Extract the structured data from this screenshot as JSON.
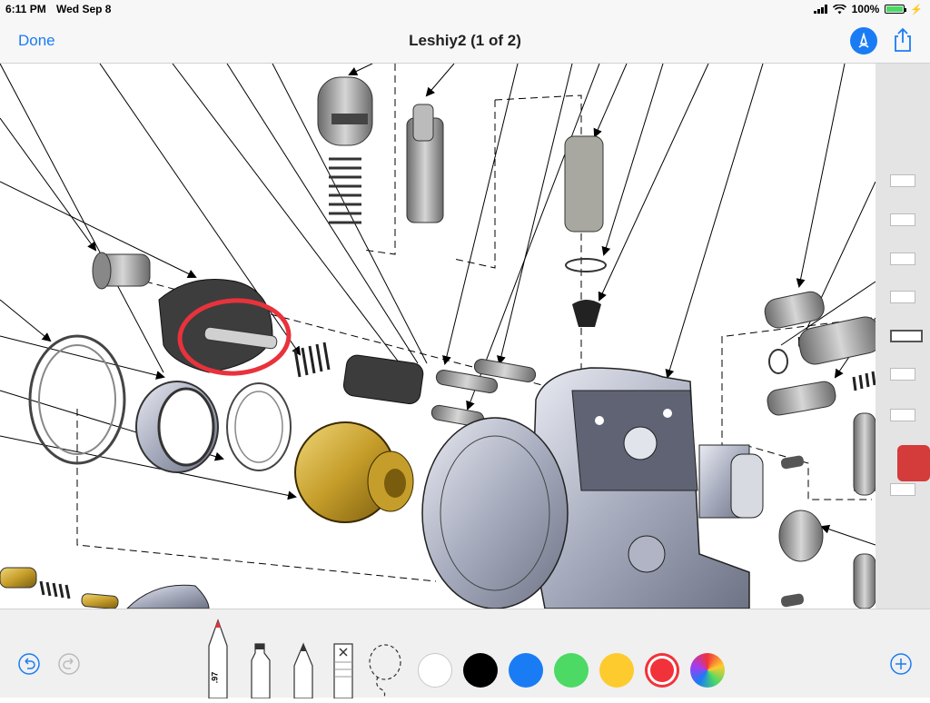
{
  "status_bar": {
    "time": "6:11 PM",
    "date": "Wed Sep 8",
    "battery_text": "100%",
    "battery_level": 1.0,
    "icons": [
      "cellular-signal-icon",
      "wifi-icon",
      "battery-icon",
      "charging-bolt-icon"
    ]
  },
  "nav": {
    "done_label": "Done",
    "title": "Leshiy2 (1 of 2)",
    "markup_icon": "markup-pen-icon",
    "share_icon": "share-icon"
  },
  "document": {
    "annotation_color": "#e8323c"
  },
  "toolbar": {
    "undo_icon": "undo-icon",
    "redo_icon": "redo-icon",
    "pen_width_label": ".97",
    "tools": [
      "pen-tool",
      "highlighter-tool",
      "pencil-tool",
      "eraser-tool",
      "lasso-tool"
    ],
    "colors": [
      {
        "name": "white",
        "hex": "#ffffff"
      },
      {
        "name": "black",
        "hex": "#000000"
      },
      {
        "name": "blue",
        "hex": "#1a7cf5"
      },
      {
        "name": "green",
        "hex": "#4cd964"
      },
      {
        "name": "yellow",
        "hex": "#fdcb2e"
      },
      {
        "name": "red",
        "hex": "#f2323a",
        "selected": true
      },
      {
        "name": "multicolor",
        "hex": "conic"
      }
    ],
    "add_icon": "add-icon"
  }
}
